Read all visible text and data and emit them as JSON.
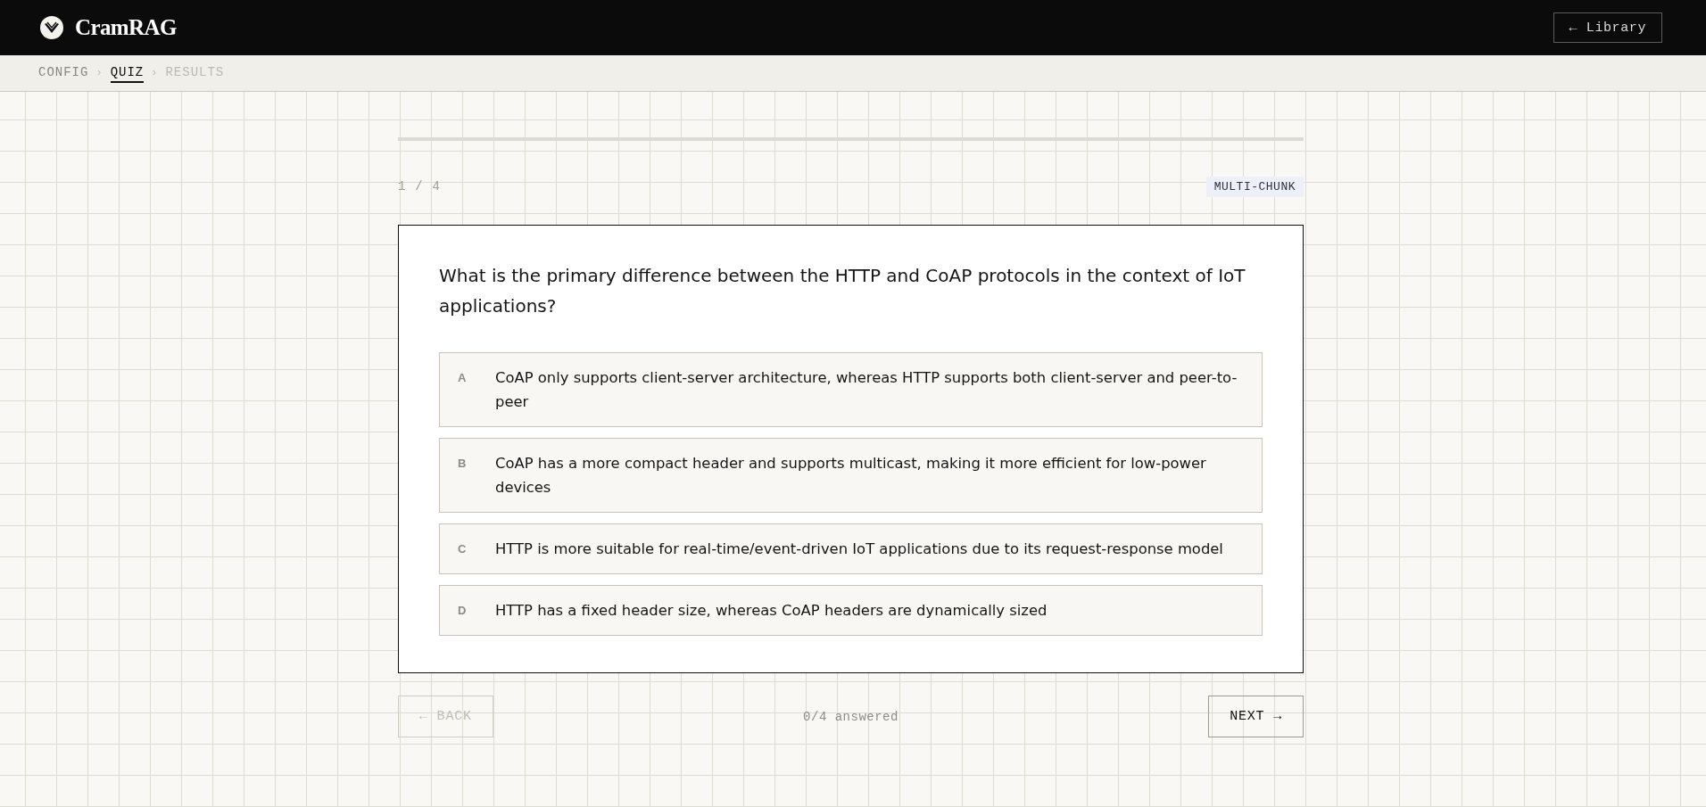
{
  "header": {
    "brand": "CramRAG",
    "library_button": "← Library"
  },
  "breadcrumb": {
    "steps": [
      {
        "label": "CONFIG",
        "selected": false,
        "disabled": false
      },
      {
        "label": "QUIZ",
        "selected": true,
        "disabled": false
      },
      {
        "label": "RESULTS",
        "selected": false,
        "disabled": true
      }
    ],
    "separators": [
      "›",
      "›"
    ]
  },
  "quiz": {
    "progress": {
      "level": 0
    },
    "counter": "1 / 4",
    "tag": "MULTI-CHUNK",
    "question": "What is the primary difference between the HTTP and CoAP protocols in the context of IoT applications?",
    "options": [
      {
        "letter": "A",
        "text": "CoAP only supports client-server architecture, whereas HTTP supports both client-server and peer-to-peer",
        "selected": false
      },
      {
        "letter": "B",
        "text": "CoAP has a more compact header and supports multicast, making it more efficient for low-power devices",
        "selected": false
      },
      {
        "letter": "C",
        "text": "HTTP is more suitable for real-time/event-driven IoT applications due to its request-response model",
        "selected": false
      },
      {
        "letter": "D",
        "text": "HTTP has a fixed header size, whereas CoAP headers are dynamically sized",
        "selected": false
      }
    ]
  },
  "footer": {
    "back_button": {
      "label": "← BACK",
      "disabled": true
    },
    "answered": "0/4 answered",
    "next_button": {
      "label": "NEXT →",
      "disabled": false
    }
  }
}
